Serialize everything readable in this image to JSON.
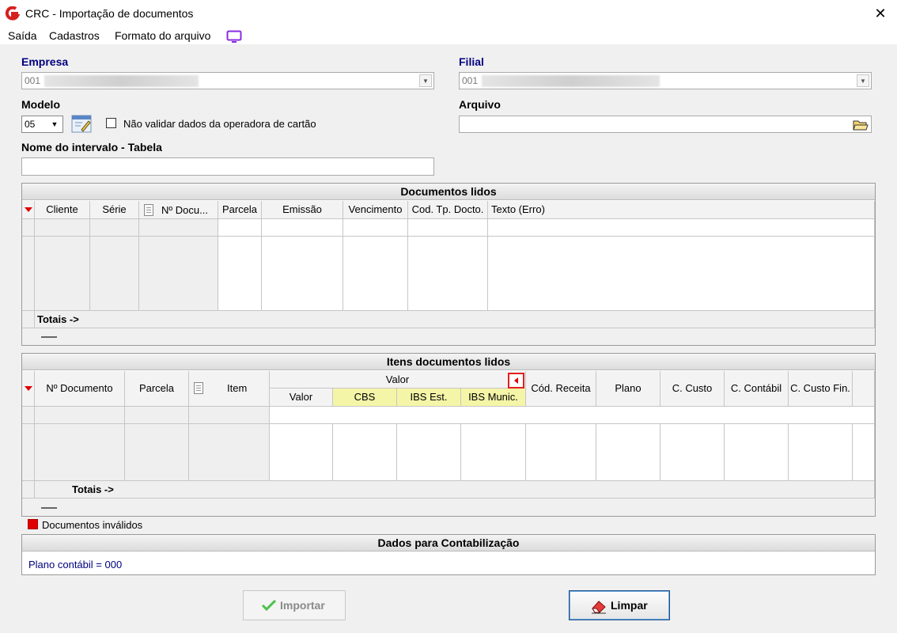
{
  "window": {
    "title": "CRC - Importação de documentos",
    "close_glyph": "✕"
  },
  "menu": {
    "items": [
      "Saída",
      "Cadastros",
      "Formato do arquivo"
    ]
  },
  "form": {
    "empresa_label": "Empresa",
    "empresa_value": "001",
    "filial_label": "Filial",
    "filial_value": "001",
    "modelo_label": "Modelo",
    "modelo_value": "05",
    "checkbox_label": "Não validar dados da operadora de cartão",
    "arquivo_label": "Arquivo",
    "arquivo_value": "",
    "intervalo_label": "Nome do intervalo - Tabela",
    "intervalo_value": ""
  },
  "docs_grid": {
    "title": "Documentos lidos",
    "columns": [
      "Cliente",
      "Série",
      "Nº Docu...",
      "Parcela",
      "Emissão",
      "Vencimento",
      "Cod. Tp. Docto.",
      "Texto (Erro)"
    ],
    "totals_label": "Totais ->"
  },
  "items_grid": {
    "title": "Itens documentos lidos",
    "columns_left": [
      "Nº Documento",
      "Parcela",
      "Item"
    ],
    "group_label": "Valor",
    "group_columns": [
      "Valor",
      "CBS",
      "IBS Est.",
      "IBS Munic."
    ],
    "columns_right": [
      "Cód. Receita",
      "Plano",
      "C. Custo",
      "C. Contábil",
      "C. Custo Fin."
    ],
    "totals_label": "Totais ->"
  },
  "legend": {
    "invalid_label": "Documentos inválidos",
    "invalid_color": "#e00000"
  },
  "contab": {
    "title": "Dados para Contabilização",
    "plano_text": "Plano contábil = 000"
  },
  "buttons": {
    "importar": "Importar",
    "limpar": "Limpar"
  },
  "colors": {
    "label_blue": "#000080",
    "highlight_yellow": "#f5f5a8",
    "marker_red": "#d00000"
  }
}
